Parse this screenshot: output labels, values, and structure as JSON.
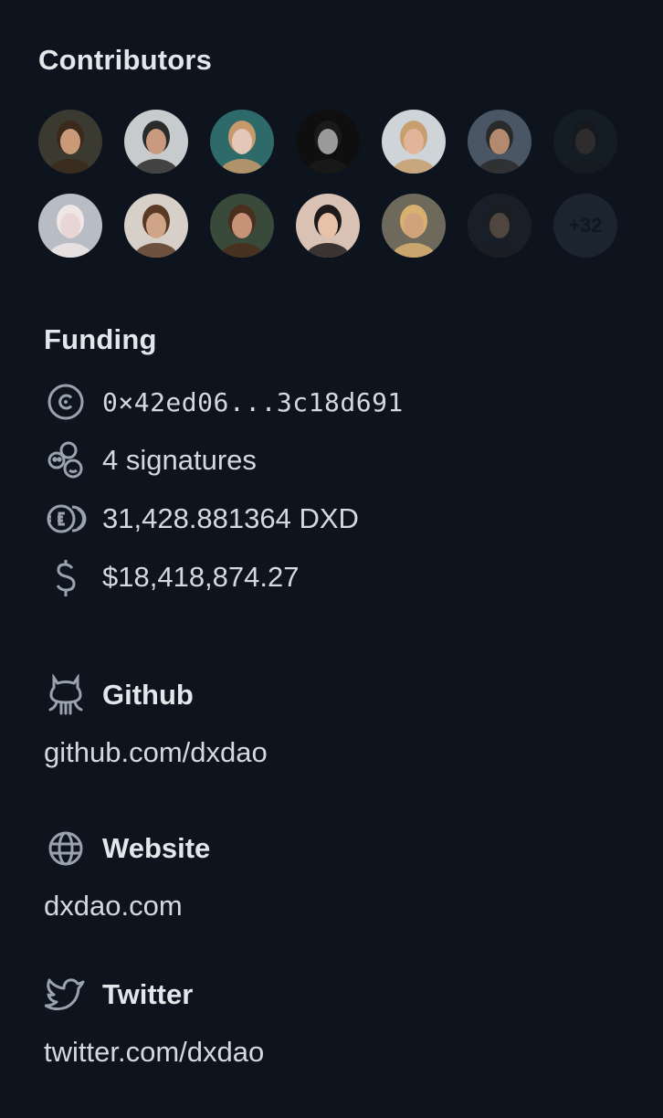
{
  "contributors": {
    "title": "Contributors",
    "more_label": "+32",
    "avatars_row1": [
      {
        "bg": "#3a3a30",
        "skin": "#c89a78",
        "hair": "#3b2a1c"
      },
      {
        "bg": "#c7cbce",
        "skin": "#c99a7d",
        "hair": "#2b2b2b"
      },
      {
        "bg": "#2f6a6a",
        "skin": "#e3c7b8",
        "hair": "#c79a6b"
      },
      {
        "bg": "#0f0f0f",
        "skin": "#9a9a9a",
        "hair": "#1a1a1a"
      },
      {
        "bg": "#cfd4d8",
        "skin": "#e2b59b",
        "hair": "#c79e6e"
      },
      {
        "bg": "#4a5663",
        "skin": "#b48a6e",
        "hair": "#2a2a2a"
      },
      {
        "bg": "#1e2630",
        "skin": "#5a4a40",
        "hair": "#222"
      }
    ],
    "avatars_row2": [
      {
        "bg": "#b8bcc4",
        "skin": "#e8d6d6",
        "hair": "#efe6e6"
      },
      {
        "bg": "#d6d0c8",
        "skin": "#cfa489",
        "hair": "#5a3a24"
      },
      {
        "bg": "#3a4a3a",
        "skin": "#c79377",
        "hair": "#4a2e1e"
      },
      {
        "bg": "#d9c2b4",
        "skin": "#e8c2a8",
        "hair": "#1e1a1a"
      },
      {
        "bg": "#6d6a5c",
        "skin": "#d0a37d",
        "hair": "#d8b070"
      },
      {
        "bg": "#262d35",
        "skin": "#a58468",
        "hair": "#2b2b2b"
      }
    ]
  },
  "funding": {
    "title": "Funding",
    "address": "0×42ed06...3c18d691",
    "signatures": "4 signatures",
    "balance": "31,428.881364 DXD",
    "usd": "$18,418,874.27"
  },
  "github": {
    "title": "Github",
    "url": "github.com/dxdao",
    "icon": "github-icon"
  },
  "website": {
    "title": "Website",
    "url": "dxdao.com",
    "icon": "globe-icon"
  },
  "twitter": {
    "title": "Twitter",
    "url": "twitter.com/dxdao",
    "icon": "twitter-icon"
  }
}
